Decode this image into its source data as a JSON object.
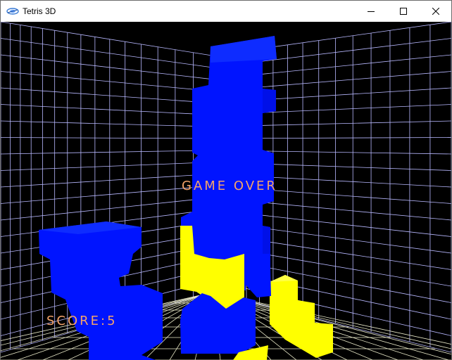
{
  "window": {
    "title": "Tetris 3D",
    "icon": "tetris-app-icon",
    "controls": {
      "minimize_icon": "minimize-icon",
      "maximize_icon": "maximize-icon",
      "close_icon": "close-icon"
    }
  },
  "game": {
    "status_text": "GAME OVER",
    "score_label": "SCORE:",
    "score_value": "5",
    "colors": {
      "background": "#000000",
      "grid_lines": "#b8b8ff",
      "block_blue": "#0014ff",
      "block_yellow": "#ffff00",
      "hud_text": "#f4a36a"
    }
  }
}
